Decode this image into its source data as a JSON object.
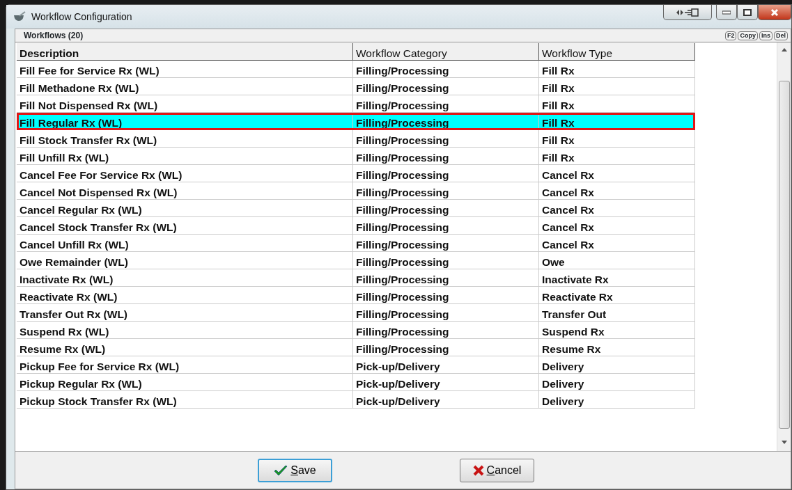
{
  "window": {
    "title": "Workflow Configuration"
  },
  "panel": {
    "title": "Workflows (20)",
    "shortcut_keys": [
      "F2",
      "Copy",
      "Ins",
      "Del"
    ]
  },
  "table": {
    "columns": [
      {
        "label": "Description",
        "bold": true
      },
      {
        "label": "Workflow Category",
        "bold": false
      },
      {
        "label": "Workflow Type",
        "bold": false
      }
    ],
    "rows": [
      {
        "cells": [
          "Fill Fee for Service Rx (WL)",
          "Filling/Processing",
          "Fill Rx"
        ],
        "selected": false
      },
      {
        "cells": [
          "Fill Methadone Rx (WL)",
          "Filling/Processing",
          "Fill Rx"
        ],
        "selected": false
      },
      {
        "cells": [
          "Fill Not Dispensed Rx (WL)",
          "Filling/Processing",
          "Fill Rx"
        ],
        "selected": false
      },
      {
        "cells": [
          "Fill Regular Rx (WL)",
          "Filling/Processing",
          "Fill Rx"
        ],
        "selected": true
      },
      {
        "cells": [
          "Fill Stock Transfer Rx (WL)",
          "Filling/Processing",
          "Fill Rx"
        ],
        "selected": false
      },
      {
        "cells": [
          "Fill Unfill Rx (WL)",
          "Filling/Processing",
          "Fill Rx"
        ],
        "selected": false
      },
      {
        "cells": [
          "Cancel Fee For Service Rx (WL)",
          "Filling/Processing",
          "Cancel Rx"
        ],
        "selected": false
      },
      {
        "cells": [
          "Cancel Not Dispensed Rx (WL)",
          "Filling/Processing",
          "Cancel Rx"
        ],
        "selected": false
      },
      {
        "cells": [
          "Cancel Regular Rx (WL)",
          "Filling/Processing",
          "Cancel Rx"
        ],
        "selected": false
      },
      {
        "cells": [
          "Cancel Stock Transfer Rx (WL)",
          "Filling/Processing",
          "Cancel Rx"
        ],
        "selected": false
      },
      {
        "cells": [
          "Cancel Unfill Rx (WL)",
          "Filling/Processing",
          "Cancel Rx"
        ],
        "selected": false
      },
      {
        "cells": [
          "Owe Remainder (WL)",
          "Filling/Processing",
          "Owe"
        ],
        "selected": false
      },
      {
        "cells": [
          "Inactivate Rx (WL)",
          "Filling/Processing",
          "Inactivate Rx"
        ],
        "selected": false
      },
      {
        "cells": [
          "Reactivate Rx (WL)",
          "Filling/Processing",
          "Reactivate Rx"
        ],
        "selected": false
      },
      {
        "cells": [
          "Transfer Out Rx (WL)",
          "Filling/Processing",
          "Transfer Out"
        ],
        "selected": false
      },
      {
        "cells": [
          "Suspend Rx (WL)",
          "Filling/Processing",
          "Suspend Rx"
        ],
        "selected": false
      },
      {
        "cells": [
          "Resume Rx (WL)",
          "Filling/Processing",
          "Resume Rx"
        ],
        "selected": false
      },
      {
        "cells": [
          "Pickup Fee for Service Rx (WL)",
          "Pick-up/Delivery",
          "Delivery"
        ],
        "selected": false
      },
      {
        "cells": [
          "Pickup Regular Rx (WL)",
          "Pick-up/Delivery",
          "Delivery"
        ],
        "selected": false
      },
      {
        "cells": [
          "Pickup Stock Transfer Rx (WL)",
          "Pick-up/Delivery",
          "Delivery"
        ],
        "selected": false
      }
    ]
  },
  "buttons": [
    {
      "label": "Save",
      "kind": "save"
    },
    {
      "label": "Cancel",
      "kind": "cancel"
    }
  ]
}
